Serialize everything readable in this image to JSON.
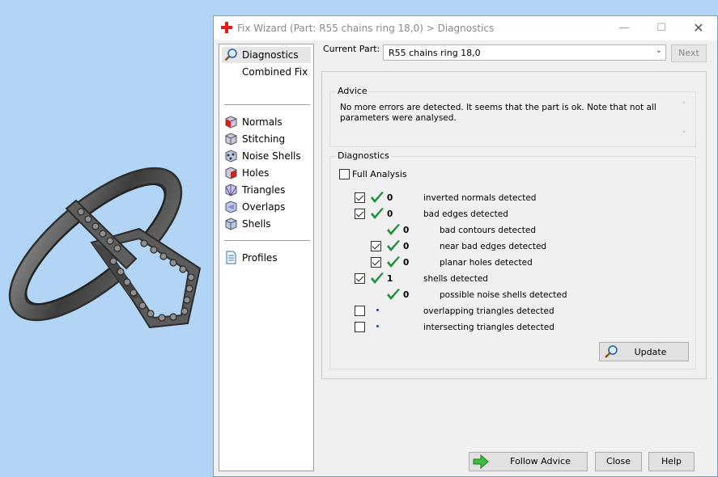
{
  "window": {
    "title": "Fix Wizard (Part: R55 chains ring  18,0) > Diagnostics",
    "icon": "red-cross-icon",
    "controls": {
      "minimize": "—",
      "maximize": "☐",
      "close": "✕"
    }
  },
  "nav": {
    "items": [
      {
        "label": "Diagnostics",
        "icon": "magnifier-icon",
        "selected": true
      },
      {
        "label": "Combined Fix",
        "icon": "none"
      },
      {
        "label": "Normals",
        "icon": "normals-cube-icon"
      },
      {
        "label": "Stitching",
        "icon": "stitching-cube-icon"
      },
      {
        "label": "Noise Shells",
        "icon": "noise-shells-icon"
      },
      {
        "label": "Holes",
        "icon": "holes-cube-icon"
      },
      {
        "label": "Triangles",
        "icon": "triangles-icon"
      },
      {
        "label": "Overlaps",
        "icon": "overlaps-icon"
      },
      {
        "label": "Shells",
        "icon": "shells-icon"
      },
      {
        "label": "Profiles",
        "icon": "profile-document-icon"
      }
    ]
  },
  "current_part": {
    "label": "Current Part:",
    "value": "R55 chains ring  18,0",
    "arrow": "⌄"
  },
  "next_label": "Next",
  "advice": {
    "title": "Advice",
    "text": "No more errors are detected. It seems that the part is ok. Note that not all parameters were analysed.",
    "scroll_up": "˄",
    "scroll_down": "˅"
  },
  "diagnostics": {
    "title": "Diagnostics",
    "full_analysis_label": "Full Analysis",
    "full_analysis_checked": false,
    "rows": [
      {
        "checkbox": true,
        "checked": true,
        "status": "ok",
        "count": "0",
        "text": "inverted normals detected",
        "indent": 0
      },
      {
        "checkbox": true,
        "checked": true,
        "status": "ok",
        "count": "0",
        "text": "bad edges detected",
        "indent": 0
      },
      {
        "checkbox": false,
        "checked": false,
        "status": "ok",
        "count": "0",
        "text": "bad contours detected",
        "indent": 1
      },
      {
        "checkbox": true,
        "checked": true,
        "status": "ok",
        "count": "0",
        "text": "near bad edges detected",
        "indent": 1
      },
      {
        "checkbox": true,
        "checked": true,
        "status": "ok",
        "count": "0",
        "text": "planar holes detected",
        "indent": 1
      },
      {
        "checkbox": true,
        "checked": true,
        "status": "ok",
        "count": "1",
        "text": "shells detected",
        "indent": 0
      },
      {
        "checkbox": false,
        "checked": false,
        "status": "ok",
        "count": "0",
        "text": "possible noise shells detected",
        "indent": 1
      },
      {
        "checkbox": true,
        "checked": false,
        "status": "pending",
        "count": "",
        "text": "overlapping triangles detected",
        "indent": 0
      },
      {
        "checkbox": true,
        "checked": false,
        "status": "pending",
        "count": "",
        "text": "intersecting triangles detected",
        "indent": 0
      }
    ]
  },
  "update_label": "Update",
  "footer": {
    "follow_advice": "Follow Advice",
    "close": "Close",
    "help": "Help"
  },
  "colors": {
    "viewport_bg": "#b3d5f5",
    "ok_check": "#1e8f3a",
    "pending_dot": "#1a3fbf"
  }
}
